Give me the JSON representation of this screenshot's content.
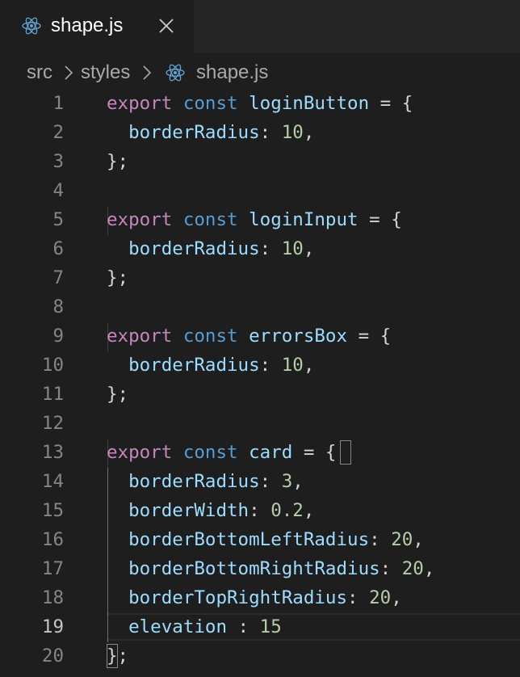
{
  "tab": {
    "title": "shape.js",
    "icon": "react-icon",
    "close_icon": "close-icon"
  },
  "breadcrumb": {
    "items": [
      "src",
      "styles",
      "shape.js"
    ],
    "separator_icon": "chevron-right-icon",
    "file_icon": "react-icon"
  },
  "colors": {
    "background": "#1e1e1e",
    "keyword": "#c586c0",
    "storage": "#569cd6",
    "identifier": "#9cdcfe",
    "number": "#b5cea8",
    "punctuation": "#d4d4d4",
    "line_number": "#858585"
  },
  "code": {
    "active_line": 19,
    "lines": [
      {
        "n": "1",
        "tokens": [
          [
            "kw",
            "export"
          ],
          [
            "pn",
            " "
          ],
          [
            "st",
            "const"
          ],
          [
            "pn",
            " "
          ],
          [
            "id",
            "loginButton"
          ],
          [
            "pn",
            " = {"
          ]
        ]
      },
      {
        "n": "2",
        "tokens": [
          [
            "pn",
            "  "
          ],
          [
            "id",
            "borderRadius"
          ],
          [
            "pn",
            ": "
          ],
          [
            "num",
            "10"
          ],
          [
            "pn",
            ","
          ]
        ]
      },
      {
        "n": "3",
        "tokens": [
          [
            "pn",
            "};"
          ]
        ]
      },
      {
        "n": "4",
        "tokens": []
      },
      {
        "n": "5",
        "tokens": [
          [
            "kw",
            "export"
          ],
          [
            "pn",
            " "
          ],
          [
            "st",
            "const"
          ],
          [
            "pn",
            " "
          ],
          [
            "id",
            "loginInput"
          ],
          [
            "pn",
            " = {"
          ]
        ]
      },
      {
        "n": "6",
        "tokens": [
          [
            "pn",
            "  "
          ],
          [
            "id",
            "borderRadius"
          ],
          [
            "pn",
            ": "
          ],
          [
            "num",
            "10"
          ],
          [
            "pn",
            ","
          ]
        ]
      },
      {
        "n": "7",
        "tokens": [
          [
            "pn",
            "};"
          ]
        ]
      },
      {
        "n": "8",
        "tokens": []
      },
      {
        "n": "9",
        "tokens": [
          [
            "kw",
            "export"
          ],
          [
            "pn",
            " "
          ],
          [
            "st",
            "const"
          ],
          [
            "pn",
            " "
          ],
          [
            "id",
            "errorsBox"
          ],
          [
            "pn",
            " = {"
          ]
        ]
      },
      {
        "n": "10",
        "tokens": [
          [
            "pn",
            "  "
          ],
          [
            "id",
            "borderRadius"
          ],
          [
            "pn",
            ": "
          ],
          [
            "num",
            "10"
          ],
          [
            "pn",
            ","
          ]
        ]
      },
      {
        "n": "11",
        "tokens": [
          [
            "pn",
            "};"
          ]
        ]
      },
      {
        "n": "12",
        "tokens": []
      },
      {
        "n": "13",
        "tokens": [
          [
            "kw",
            "export"
          ],
          [
            "pn",
            " "
          ],
          [
            "st",
            "const"
          ],
          [
            "pn",
            " "
          ],
          [
            "id",
            "card"
          ],
          [
            "pn",
            " = {"
          ]
        ]
      },
      {
        "n": "14",
        "tokens": [
          [
            "pn",
            "  "
          ],
          [
            "id",
            "borderRadius"
          ],
          [
            "pn",
            ": "
          ],
          [
            "num",
            "3"
          ],
          [
            "pn",
            ","
          ]
        ]
      },
      {
        "n": "15",
        "tokens": [
          [
            "pn",
            "  "
          ],
          [
            "id",
            "borderWidth"
          ],
          [
            "pn",
            ": "
          ],
          [
            "num",
            "0.2"
          ],
          [
            "pn",
            ","
          ]
        ]
      },
      {
        "n": "16",
        "tokens": [
          [
            "pn",
            "  "
          ],
          [
            "id",
            "borderBottomLeftRadius"
          ],
          [
            "pn",
            ": "
          ],
          [
            "num",
            "20"
          ],
          [
            "pn",
            ","
          ]
        ]
      },
      {
        "n": "17",
        "tokens": [
          [
            "pn",
            "  "
          ],
          [
            "id",
            "borderBottomRightRadius"
          ],
          [
            "pn",
            ": "
          ],
          [
            "num",
            "20"
          ],
          [
            "pn",
            ","
          ]
        ]
      },
      {
        "n": "18",
        "tokens": [
          [
            "pn",
            "  "
          ],
          [
            "id",
            "borderTopRightRadius"
          ],
          [
            "pn",
            ": "
          ],
          [
            "num",
            "20"
          ],
          [
            "pn",
            ","
          ]
        ]
      },
      {
        "n": "19",
        "tokens": [
          [
            "pn",
            "  "
          ],
          [
            "id",
            "elevation"
          ],
          [
            "pn",
            " : "
          ],
          [
            "num",
            "15"
          ]
        ]
      },
      {
        "n": "20",
        "tokens": [
          [
            "pn",
            "};"
          ]
        ]
      }
    ]
  }
}
